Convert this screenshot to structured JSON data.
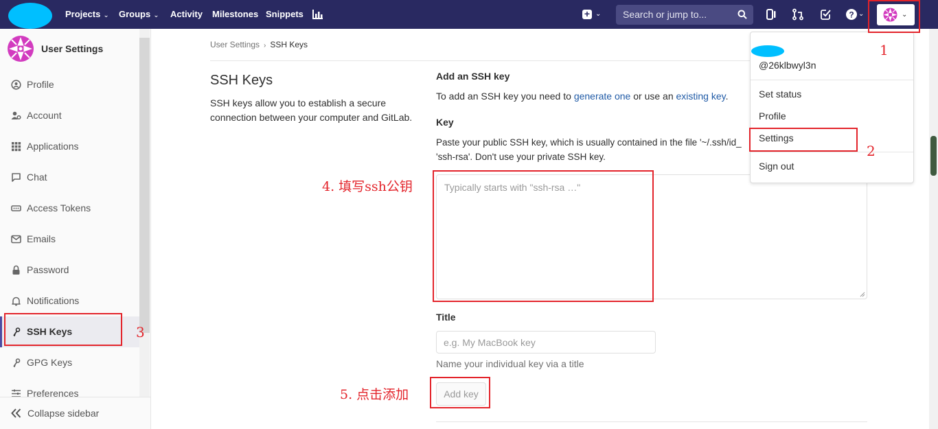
{
  "nav": {
    "projects": "Projects",
    "groups": "Groups",
    "activity": "Activity",
    "milestones": "Milestones",
    "snippets": "Snippets",
    "search_placeholder": "Search or jump to...",
    "brand_color": "#292961"
  },
  "dropdown": {
    "username": "@26klbwyl3n",
    "items": [
      "Set status",
      "Profile",
      "Settings",
      "Sign out"
    ]
  },
  "sidebar": {
    "title": "User Settings",
    "items": [
      {
        "label": "Profile",
        "icon": "profile-icon"
      },
      {
        "label": "Account",
        "icon": "account-icon"
      },
      {
        "label": "Applications",
        "icon": "applications-icon"
      },
      {
        "label": "Chat",
        "icon": "chat-icon"
      },
      {
        "label": "Access Tokens",
        "icon": "access-tokens-icon"
      },
      {
        "label": "Emails",
        "icon": "emails-icon"
      },
      {
        "label": "Password",
        "icon": "password-icon"
      },
      {
        "label": "Notifications",
        "icon": "notifications-icon"
      },
      {
        "label": "SSH Keys",
        "icon": "ssh-key-icon"
      },
      {
        "label": "GPG Keys",
        "icon": "gpg-key-icon"
      },
      {
        "label": "Preferences",
        "icon": "preferences-icon"
      }
    ],
    "active": "SSH Keys",
    "collapse_label": "Collapse sidebar"
  },
  "breadcrumb": {
    "parent": "User Settings",
    "current": "SSH Keys"
  },
  "main": {
    "heading": "SSH Keys",
    "description": "SSH keys allow you to establish a secure connection between your computer and GitLab.",
    "add_heading": "Add an SSH key",
    "add_text_before": "To add an SSH key you need to ",
    "generate_link": "generate one",
    "add_text_middle": " or use an ",
    "existing_link": "existing key",
    "add_text_after": ".",
    "key_label": "Key",
    "key_help_line1": "Paste your public SSH key, which is usually contained in the file '~/.ssh/id_",
    "key_help_line2": "'ssh-rsa'. Don't use your private SSH key.",
    "key_placeholder": "Typically starts with \"ssh-rsa …\"",
    "title_label": "Title",
    "title_placeholder": "e.g. My MacBook key",
    "title_help": "Name your individual key via a title",
    "add_key_button": "Add key"
  },
  "annotations": {
    "step1": "1",
    "step2": "2",
    "step3": "3",
    "step4": "4. 填写ssh公钥",
    "step5": "5. 点击添加",
    "color": "#e3232a"
  }
}
